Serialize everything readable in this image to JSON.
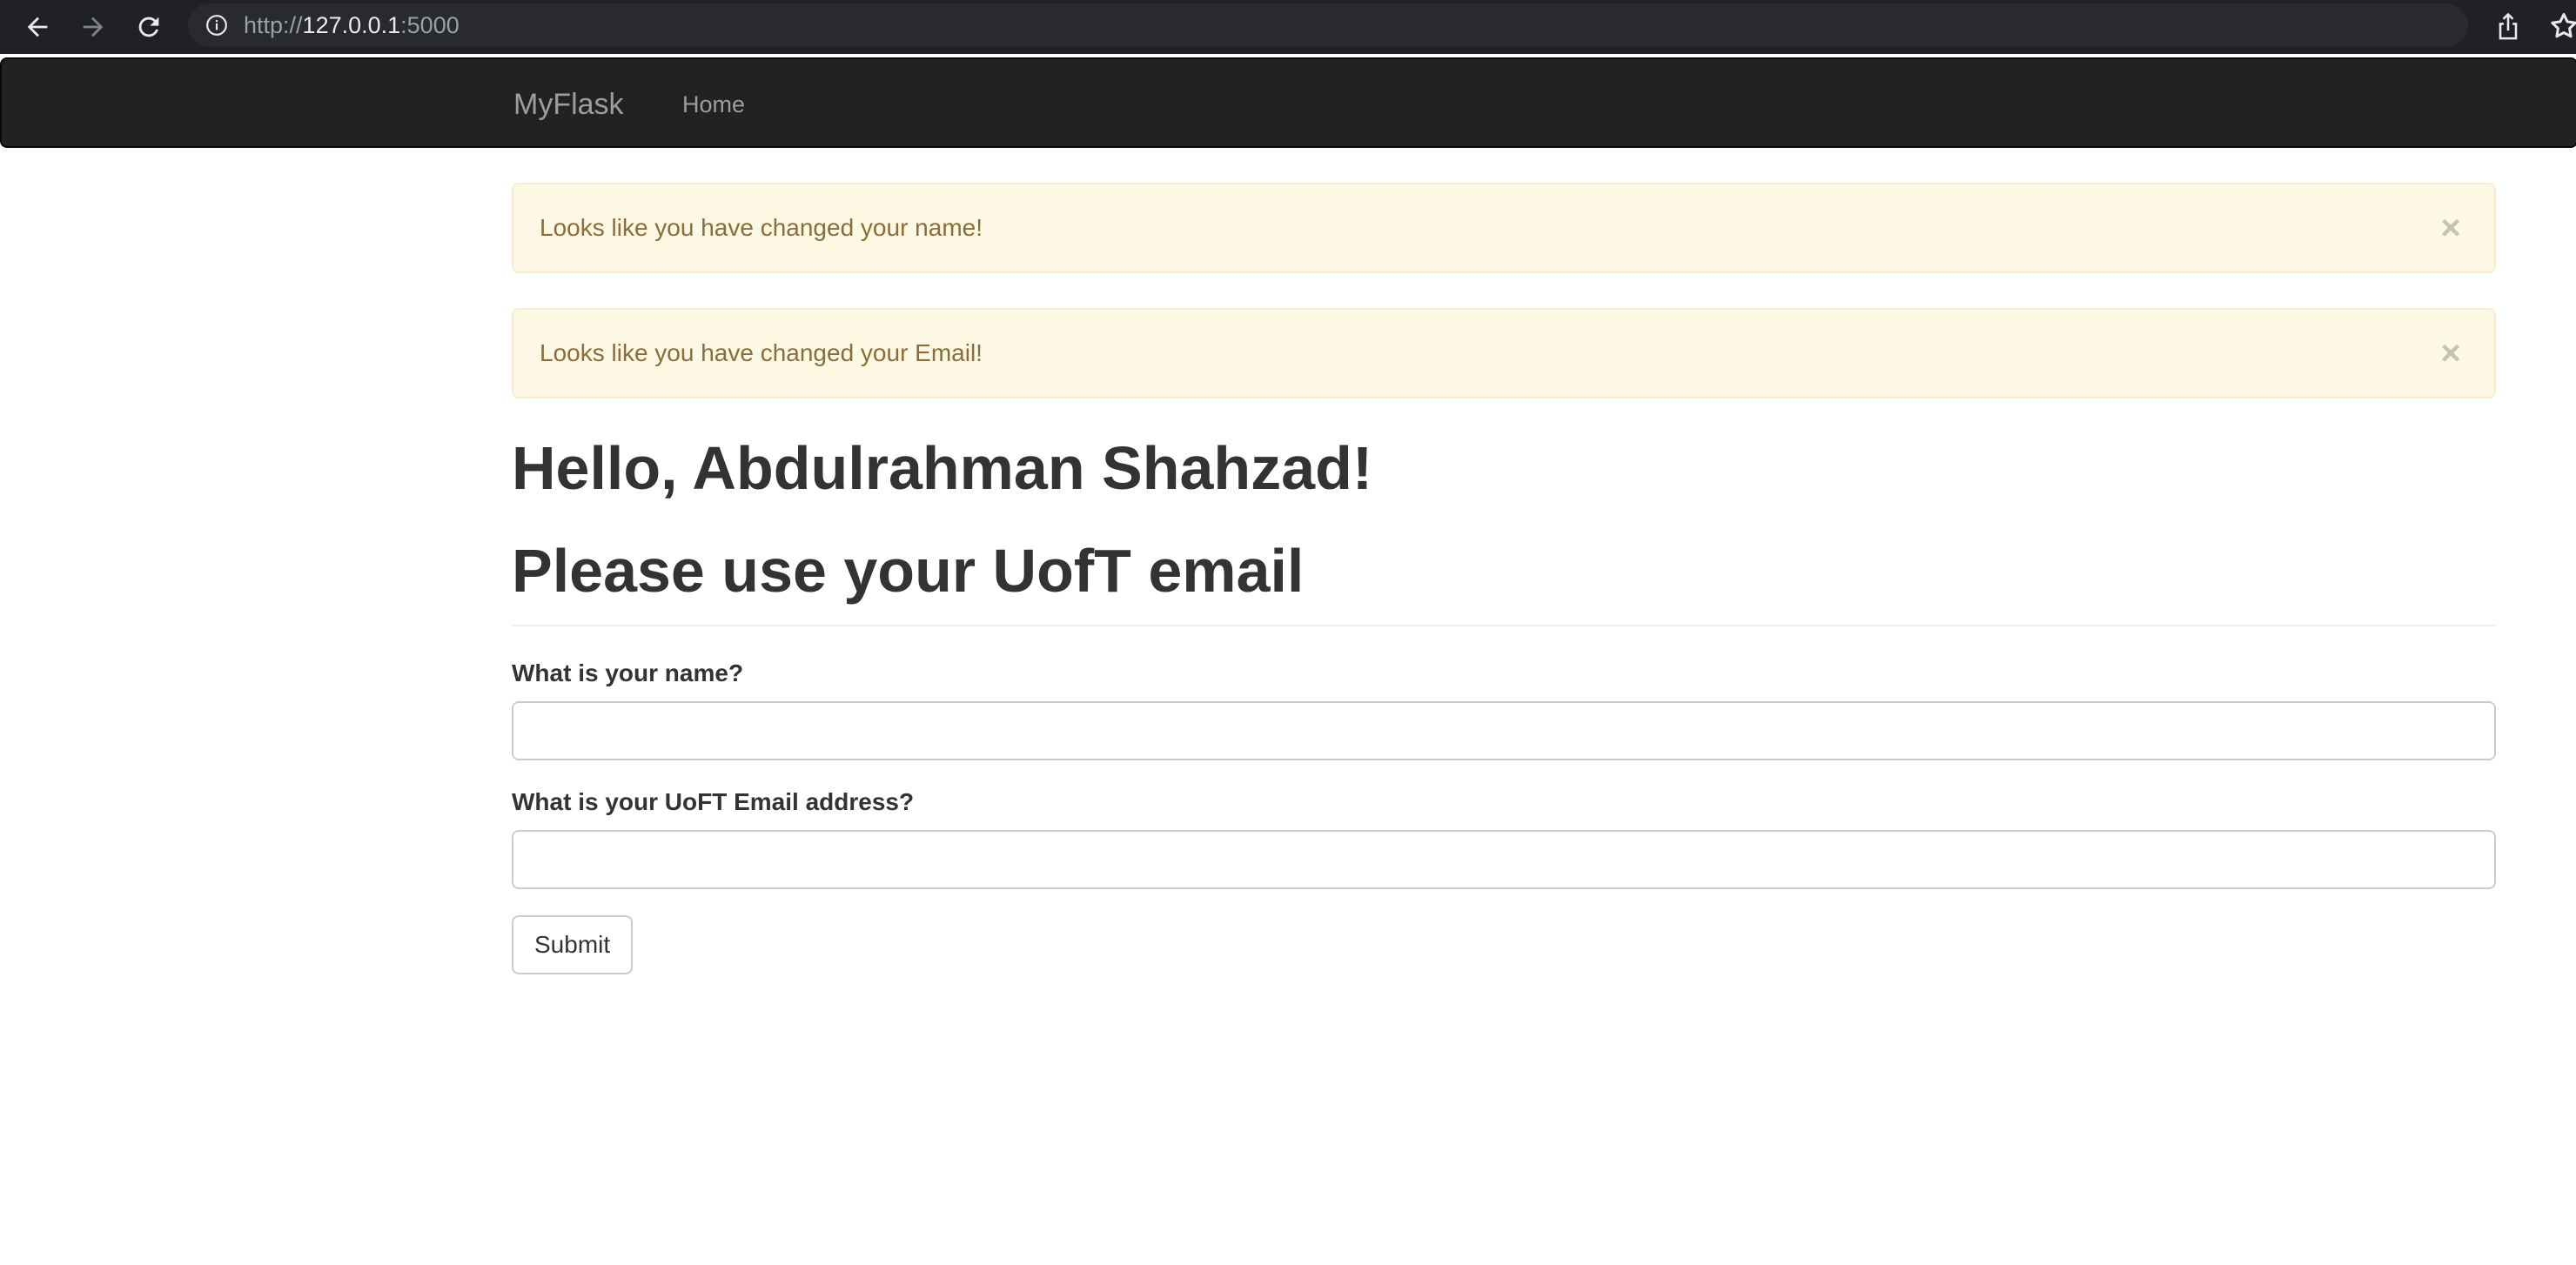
{
  "browser": {
    "url_scheme": "http://",
    "url_host": "127.0.0.1",
    "url_port": ":5000"
  },
  "navbar": {
    "brand": "MyFlask",
    "links": [
      {
        "label": "Home"
      }
    ]
  },
  "alerts": [
    {
      "text": "Looks like you have changed your name!",
      "close": "×"
    },
    {
      "text": "Looks like you have changed your Email!",
      "close": "×"
    }
  ],
  "header": {
    "greeting": "Hello, Abdulrahman Shahzad!",
    "subtitle": "Please use your UofT email"
  },
  "form": {
    "name_label": "What is your name?",
    "name_value": "",
    "email_label": "What is your UoFT Email address?",
    "email_value": "",
    "submit_label": "Submit"
  },
  "colors": {
    "navbar_bg": "#222222",
    "alert_bg": "#fcf8e3",
    "alert_text": "#8a6d3b",
    "browser_bg": "#202124"
  }
}
